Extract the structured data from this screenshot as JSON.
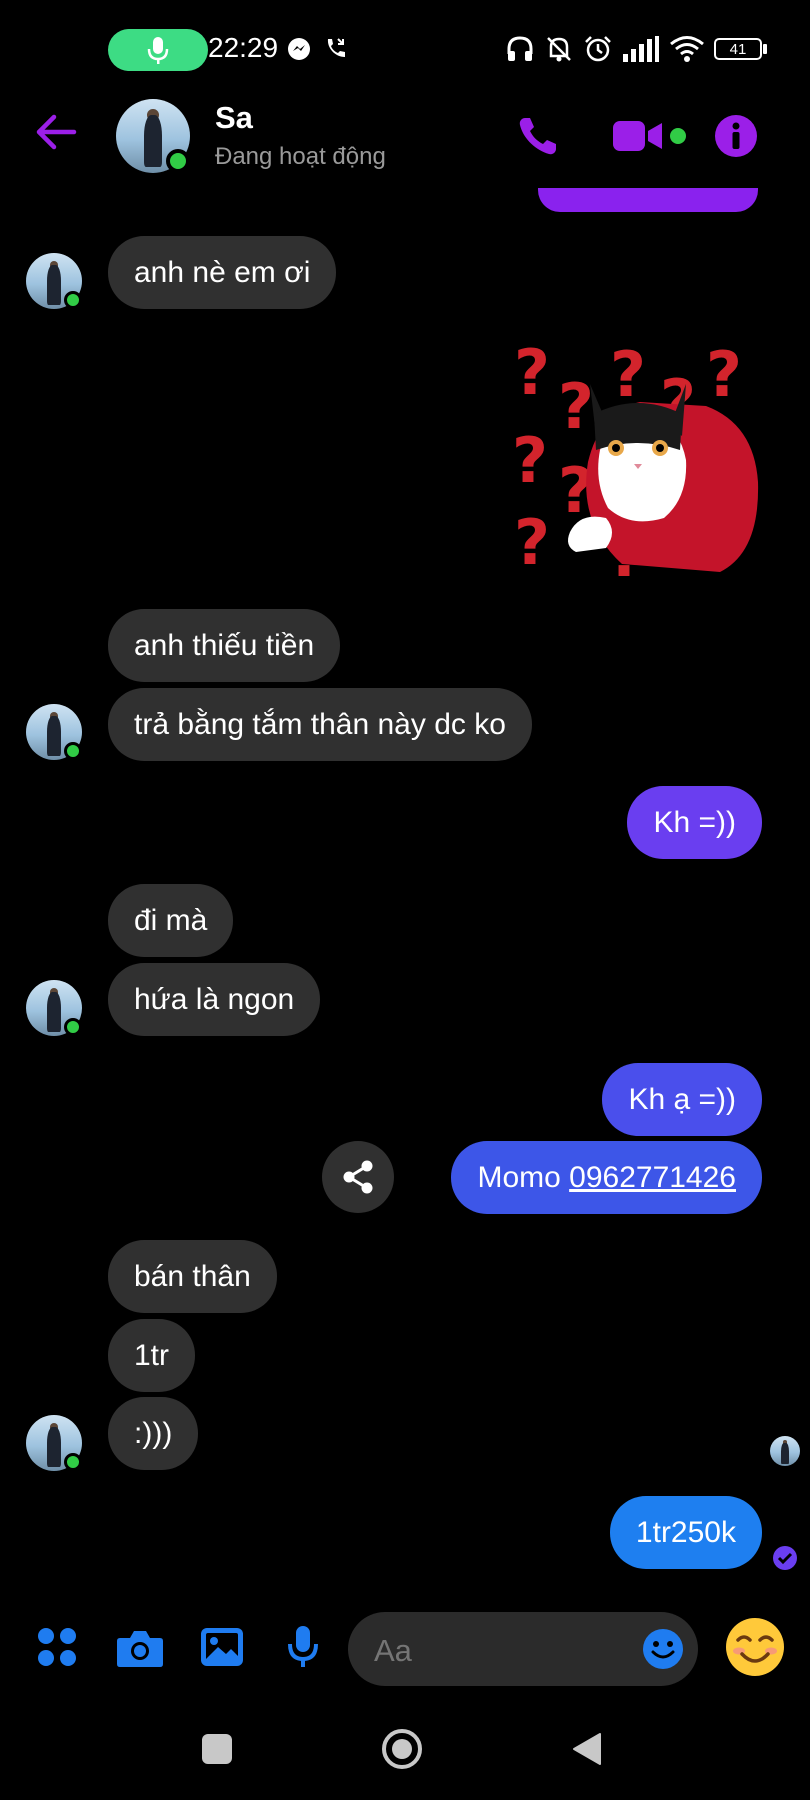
{
  "status_bar": {
    "time": "22:29",
    "battery": "41"
  },
  "header": {
    "contact_name": "Sa",
    "activity_status": "Đang hoạt động"
  },
  "messages": [
    {
      "side": "in",
      "text": "anh nè em ơi"
    },
    {
      "side": "in",
      "type": "sticker",
      "sticker": "confused-cat-sticker"
    },
    {
      "side": "in",
      "text": "anh thiếu tiền"
    },
    {
      "side": "in",
      "text": "trả bằng tắm thân này dc ko"
    },
    {
      "side": "out",
      "text": "Kh =))"
    },
    {
      "side": "in",
      "text": "đi mà"
    },
    {
      "side": "in",
      "text": "hứa là ngon"
    },
    {
      "side": "out",
      "text": "Kh ạ =))"
    },
    {
      "side": "out",
      "text": "Momo ",
      "link": "0962771426"
    },
    {
      "side": "in",
      "text": "bán thân"
    },
    {
      "side": "in",
      "text": "1tr"
    },
    {
      "side": "in",
      "text": ":)))"
    },
    {
      "side": "out",
      "text": "1tr250k"
    }
  ],
  "composer": {
    "placeholder": "Aa"
  },
  "colors": {
    "accent": "#9b1fe8",
    "bubble_out_purple": "#6a3ef0",
    "bubble_out_indigo": "#3d56e8",
    "bubble_out_blue": "#1e7ff0",
    "bubble_in": "#303030",
    "online": "#31cc46"
  }
}
